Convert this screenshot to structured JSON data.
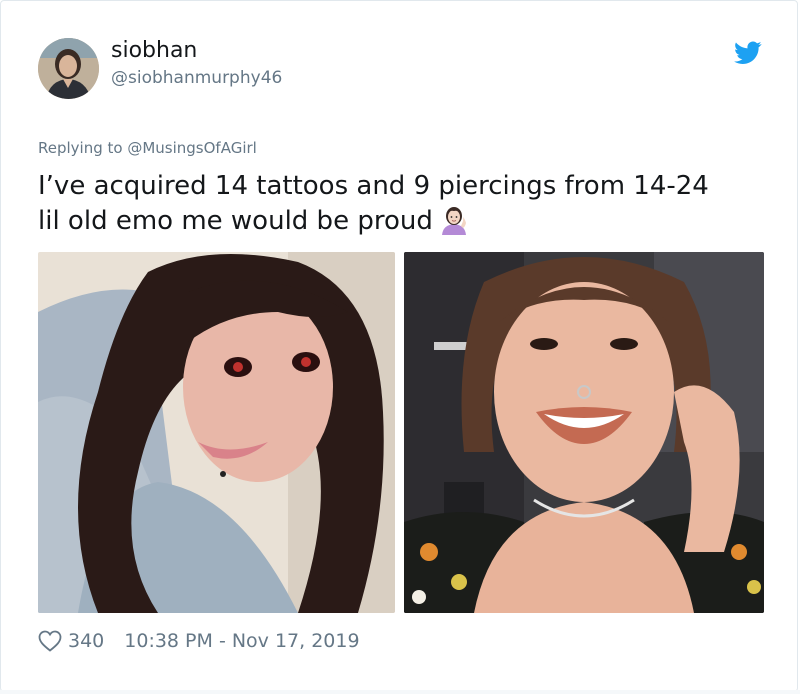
{
  "user": {
    "display_name": "siobhan",
    "handle": "@siobhanmurphy46",
    "avatar_icon": "avatar-photo"
  },
  "reply": {
    "prefix": "Replying to ",
    "mention": "@MusingsOfAGirl"
  },
  "tweet": {
    "line1": "I’ve acquired 14 tattoos and 9 piercings from 14-24",
    "line2": "lil old emo me would be proud",
    "emoji": "woman-tipping-hand-emoji"
  },
  "media": {
    "left_icon": "photo-before",
    "right_icon": "photo-after"
  },
  "footer": {
    "like_count": "340",
    "timestamp": "10:38 PM - Nov 17, 2019"
  },
  "colors": {
    "twitter_blue": "#1da1f2",
    "secondary_text": "#657786",
    "primary_text": "#14171a",
    "border": "#e1e8ed"
  }
}
